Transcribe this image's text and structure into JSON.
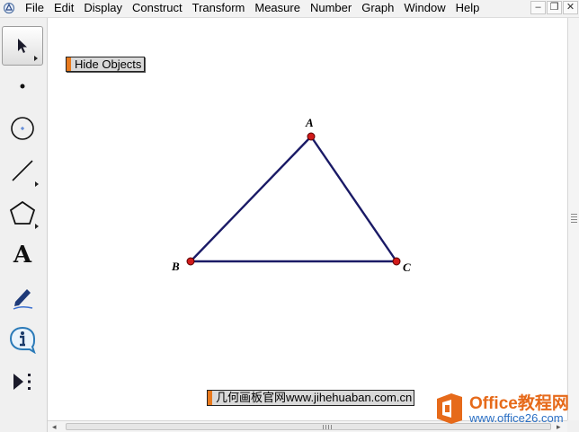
{
  "menu": {
    "items": [
      "File",
      "Edit",
      "Display",
      "Construct",
      "Transform",
      "Measure",
      "Number",
      "Graph",
      "Window",
      "Help"
    ]
  },
  "window_controls": {
    "minimize": "–",
    "restore": "❐",
    "close": "✕"
  },
  "toolbox": {
    "tools": [
      {
        "name": "arrow-tool",
        "icon": "arrow-select-icon",
        "selected": true
      },
      {
        "name": "point-tool",
        "icon": "point-icon"
      },
      {
        "name": "compass-tool",
        "icon": "compass-circle-icon"
      },
      {
        "name": "straightedge-tool",
        "icon": "line-segment-icon"
      },
      {
        "name": "polygon-tool",
        "icon": "polygon-icon"
      },
      {
        "name": "text-tool",
        "icon": "text-A-icon",
        "glyph": "A"
      },
      {
        "name": "marker-tool",
        "icon": "marker-pen-icon"
      },
      {
        "name": "information-tool",
        "icon": "info-icon"
      },
      {
        "name": "custom-tool",
        "icon": "custom-tools-icon"
      }
    ]
  },
  "canvas": {
    "hide_button_label": "Hide Objects",
    "caption": "几何画板官网www.jihehuaban.com.cn",
    "triangle": {
      "vertex_labels": {
        "A": "A",
        "B": "B",
        "C": "C"
      },
      "segment_color": "#1a1a66",
      "point_color": "#d11a1a"
    }
  },
  "watermark": {
    "title": "Office教程网",
    "url": "www.office26.com",
    "accent": "#e66a1a"
  }
}
